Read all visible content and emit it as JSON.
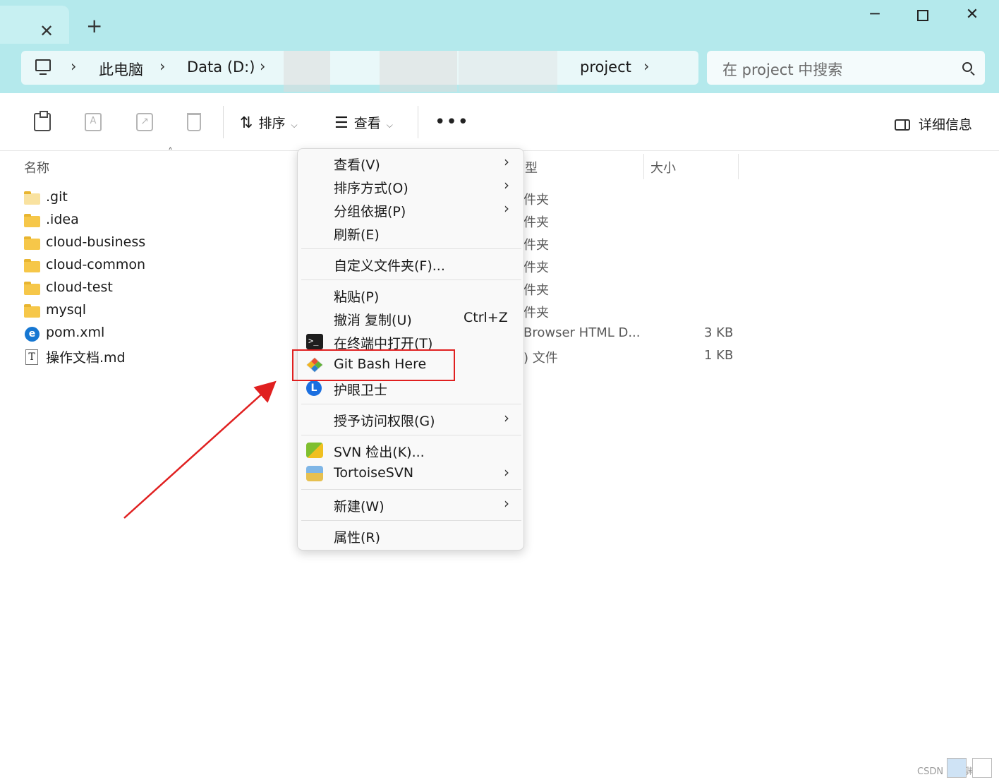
{
  "tab": {
    "close_icon": "close-icon",
    "new_tab_icon": "plus-icon"
  },
  "window": {
    "minimize": "─",
    "close": "✕"
  },
  "address": {
    "crumbs": [
      "此电脑",
      "Data (D:)",
      "project"
    ],
    "separator": "›"
  },
  "search": {
    "placeholder": "在 project 中搜索"
  },
  "toolbar": {
    "sort_label": "排序",
    "view_label": "查看",
    "more_label": "•••",
    "details_label": "详细信息"
  },
  "columns": {
    "name": "名称",
    "type_partial": "型",
    "size": "大小"
  },
  "files": [
    {
      "name": ".git",
      "kind": "folder",
      "type": "件夹",
      "size": ""
    },
    {
      "name": ".idea",
      "kind": "folder",
      "type": "件夹",
      "size": ""
    },
    {
      "name": "cloud-business",
      "kind": "folder",
      "type": "件夹",
      "size": ""
    },
    {
      "name": "cloud-common",
      "kind": "folder",
      "type": "件夹",
      "size": ""
    },
    {
      "name": "cloud-test",
      "kind": "folder",
      "type": "件夹",
      "size": ""
    },
    {
      "name": "mysql",
      "kind": "folder",
      "type": "件夹",
      "size": ""
    },
    {
      "name": "pom.xml",
      "kind": "xml",
      "type": "Browser HTML D...",
      "size": "3 KB"
    },
    {
      "name": "操作文档.md",
      "kind": "md",
      "type": ") 文件",
      "size": "1 KB"
    }
  ],
  "context_menu": {
    "view": "查看(V)",
    "sort_by": "排序方式(O)",
    "group_by": "分组依据(P)",
    "refresh": "刷新(E)",
    "customize": "自定义文件夹(F)...",
    "paste": "粘贴(P)",
    "undo_copy": "撤消 复制(U)",
    "undo_shortcut": "Ctrl+Z",
    "open_terminal": "在终端中打开(T)",
    "git_bash": "Git Bash Here",
    "eye_guard": "护眼卫士",
    "give_access": "授予访问权限(G)",
    "svn_checkout": "SVN 检出(K)...",
    "tortoise": "TortoiseSVN",
    "new": "新建(W)",
    "properties": "属性(R)",
    "submenu_arrow": "›"
  },
  "watermark": "CSDN @萧渊客",
  "colors": {
    "accent_highlight": "#e02020",
    "titlebar": "#b4e9ec"
  }
}
